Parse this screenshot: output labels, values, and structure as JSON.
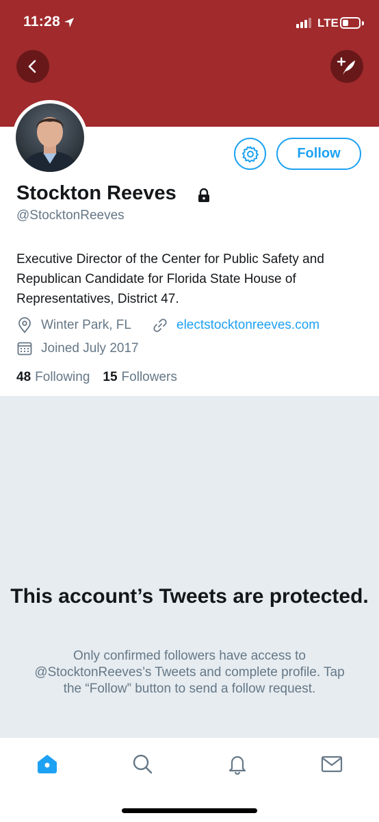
{
  "status_bar": {
    "time": "11:28",
    "network": "LTE",
    "location_icon": "location-arrow-icon",
    "battery_level": 0.35
  },
  "colors": {
    "banner": "#a02a2c",
    "accent": "#1da1f2",
    "secondary_text": "#657786",
    "protected_background": "#e6ecf0"
  },
  "header": {
    "back_icon": "chevron-left-icon",
    "compose_icon": "compose-tweet-icon"
  },
  "profile": {
    "name": "Stockton Reeves",
    "handle": "@StocktonReeves",
    "protected_icon": "lock-icon",
    "settings_icon": "gear-icon",
    "follow_label": "Follow",
    "bio": "Executive Director of the Center for Public Safety and Republican Candidate for Florida State House of Representatives, District 47.",
    "location": "Winter Park, FL",
    "website": "electstocktonreeves.com",
    "joined": "Joined July 2017",
    "following_count": "48",
    "following_label": "Following",
    "followers_count": "15",
    "followers_label": "Followers"
  },
  "protected_notice": {
    "title": "This account’s Tweets are protected.",
    "text": "Only confirmed followers have access to @StocktonReeves’s Tweets and complete profile. Tap the “Follow” button to send a follow request."
  },
  "tab_bar": {
    "items": [
      {
        "name": "home",
        "icon": "home-icon",
        "active": true
      },
      {
        "name": "search",
        "icon": "search-icon",
        "active": false
      },
      {
        "name": "notifications",
        "icon": "bell-icon",
        "active": false
      },
      {
        "name": "messages",
        "icon": "envelope-icon",
        "active": false
      }
    ]
  }
}
